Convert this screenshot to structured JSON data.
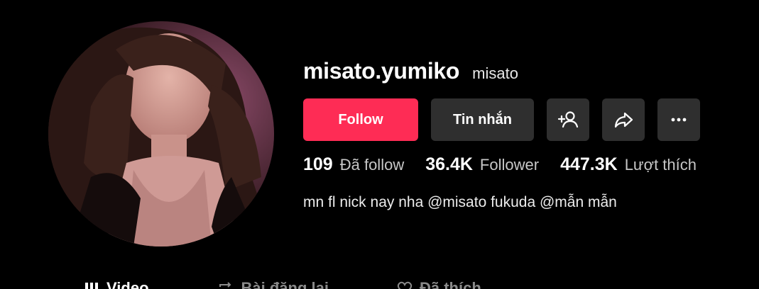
{
  "profile": {
    "username": "misato.yumiko",
    "nickname": "misato",
    "avatar_icon": "profile-photo"
  },
  "actions": {
    "follow_label": "Follow",
    "message_label": "Tin nhắn",
    "add_friend_icon": "add-user-icon",
    "share_icon": "share-icon",
    "more_icon": "more-icon",
    "accent_color": "#fe2c55"
  },
  "stats": [
    {
      "value": "109",
      "label": "Đã follow"
    },
    {
      "value": "36.4K",
      "label": "Follower"
    },
    {
      "value": "447.3K",
      "label": "Lượt thích"
    }
  ],
  "bio": "mn fl nick nay nha @misato fukuda @mẫn mẫn",
  "tabs": [
    {
      "label": "Video",
      "icon": "grid-icon"
    },
    {
      "label": "Bài đăng lại",
      "icon": "repost-icon"
    },
    {
      "label": "Đã thích",
      "icon": "heart-icon"
    }
  ]
}
